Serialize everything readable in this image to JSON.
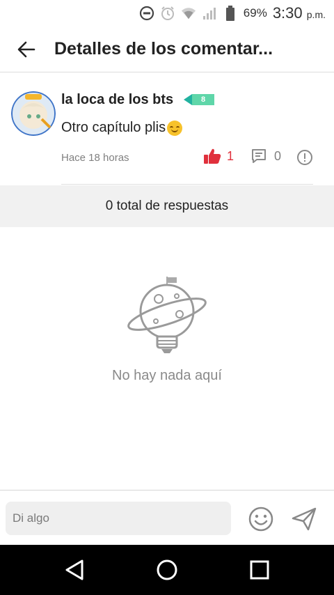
{
  "status_bar": {
    "battery_percent": "69%",
    "time": "3:30",
    "period": "p.m."
  },
  "header": {
    "title": "Detalles de los comentar..."
  },
  "comment": {
    "username": "la loca de los bts",
    "level": "8",
    "text": "Otro capítulo plis",
    "emoji": "smiling-face-emoji",
    "timestamp": "Hace 18 horas",
    "likes": "1",
    "replies": "0",
    "like_color": "#e0303c"
  },
  "replies_bar": {
    "label": "0 total de respuestas"
  },
  "empty_state": {
    "message": "No hay nada aquí"
  },
  "input": {
    "placeholder": "Di algo",
    "value": ""
  },
  "icons": {
    "back": "arrow-left-icon",
    "like": "thumbs-up-icon",
    "reply": "speech-bubble-icon",
    "report": "exclamation-circle-icon",
    "emoji": "smiley-icon",
    "send": "paper-plane-icon",
    "nav_back": "triangle-back-icon",
    "nav_home": "circle-home-icon",
    "nav_recents": "square-recents-icon"
  }
}
